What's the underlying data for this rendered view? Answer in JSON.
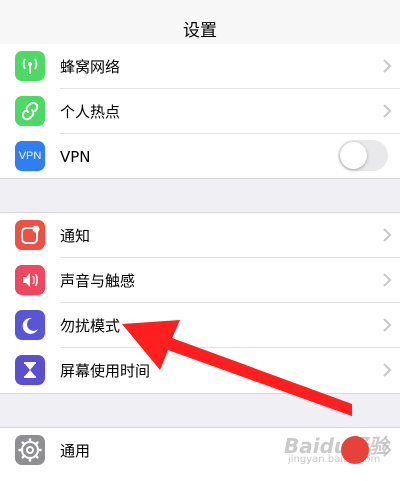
{
  "header": {
    "title": "设置"
  },
  "group1": [
    {
      "label": "蜂窝网络",
      "icon": "cellular-antenna-icon",
      "color": "#4cd964"
    },
    {
      "label": "个人热点",
      "icon": "hotspot-link-icon",
      "color": "#4cd964"
    },
    {
      "label": "VPN",
      "icon_text": "VPN",
      "icon": "vpn-icon",
      "color": "#2f7ef6",
      "toggle_on": false
    }
  ],
  "group2": [
    {
      "label": "通知",
      "icon": "notification-icon",
      "color": "#f24f43"
    },
    {
      "label": "声音与触感",
      "icon": "speaker-icon",
      "color": "#f0465f"
    },
    {
      "label": "勿扰模式",
      "icon": "moon-icon",
      "color": "#5856d6"
    },
    {
      "label": "屏幕使用时间",
      "icon": "hourglass-icon",
      "color": "#5a4fcf"
    }
  ],
  "group3": [
    {
      "label": "通用",
      "icon": "gear-icon",
      "color": "#8e8e93"
    }
  ],
  "watermark": {
    "text": "Baidu经验",
    "sub": "jingyan.baidu.com"
  }
}
